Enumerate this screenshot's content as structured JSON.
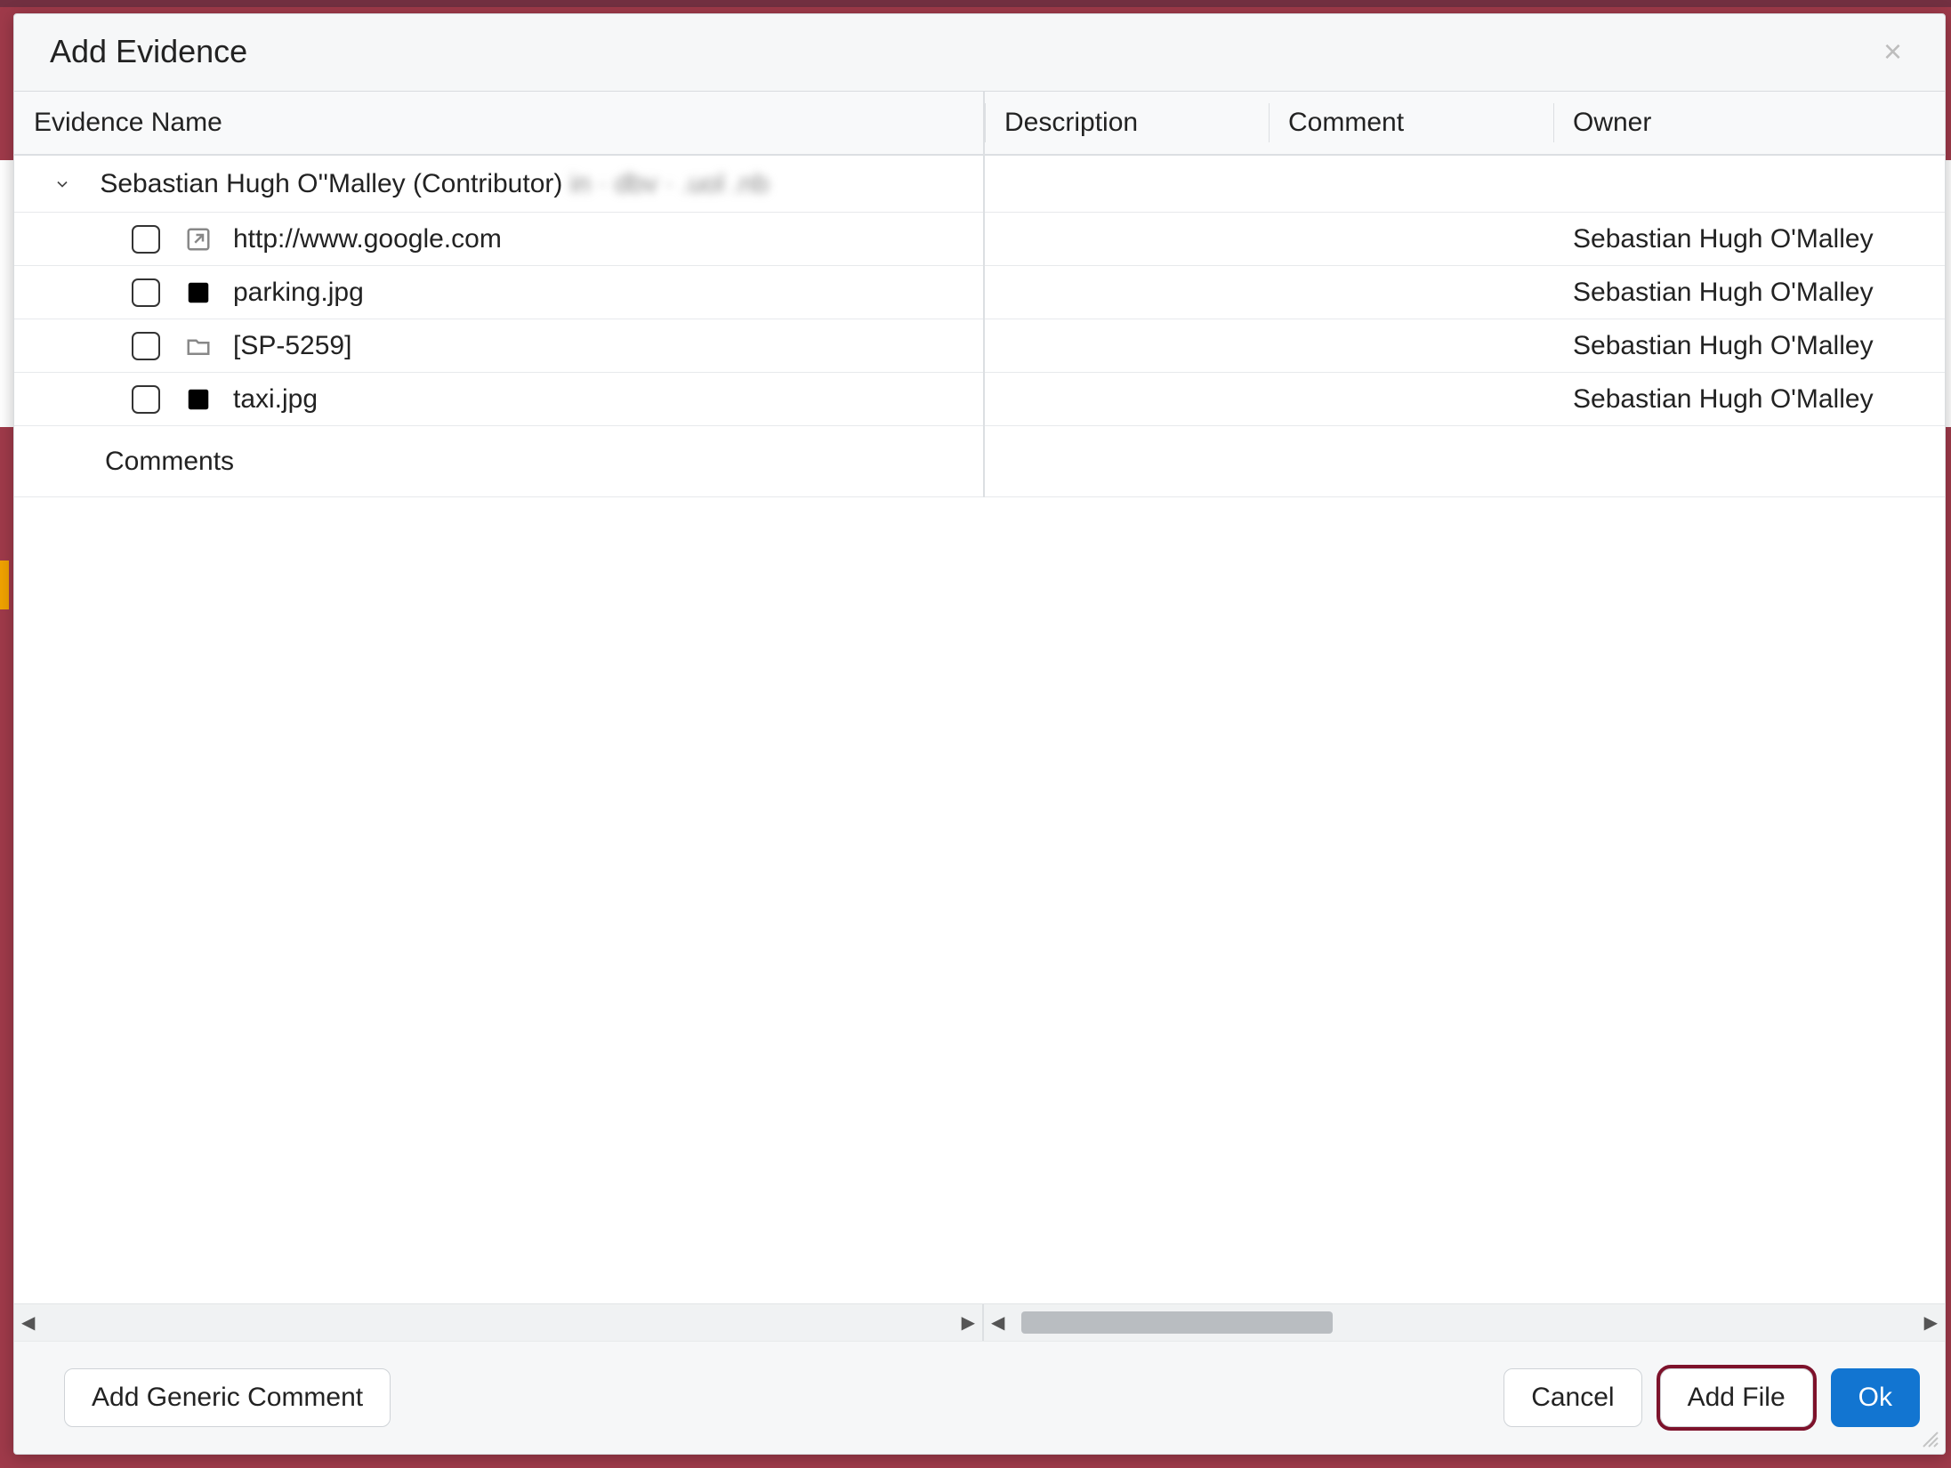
{
  "modal": {
    "title": "Add Evidence"
  },
  "columns": {
    "name": "Evidence Name",
    "description": "Description",
    "comment": "Comment",
    "owner": "Owner"
  },
  "group": {
    "label": "Sebastian Hugh O''Malley (Contributor)",
    "obscured_suffix": "in · dbv · .uol .nb"
  },
  "rows": [
    {
      "icon": "link",
      "name": "http://www.google.com",
      "owner": "Sebastian Hugh O'Malley"
    },
    {
      "icon": "image",
      "name": "parking.jpg",
      "owner": "Sebastian Hugh O'Malley"
    },
    {
      "icon": "folder",
      "name": "[SP-5259]",
      "owner": "Sebastian Hugh O'Malley"
    },
    {
      "icon": "image",
      "name": "taxi.jpg",
      "owner": "Sebastian Hugh O'Malley"
    }
  ],
  "comments_row_label": "Comments",
  "footer": {
    "add_comment": "Add Generic Comment",
    "cancel": "Cancel",
    "add_file": "Add File",
    "ok": "Ok"
  }
}
